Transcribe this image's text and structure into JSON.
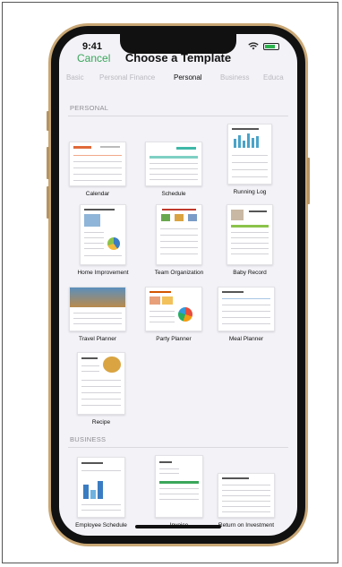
{
  "status": {
    "time": "9:41"
  },
  "nav": {
    "cancel": "Cancel",
    "title": "Choose a Template"
  },
  "tabs": [
    "Basic",
    "Personal Finance",
    "Personal",
    "Business",
    "Educa"
  ],
  "active_tab": "Personal",
  "sections": {
    "personal": {
      "label": "PERSONAL",
      "templates": [
        "Calendar",
        "Schedule",
        "Running Log",
        "Home Improvement",
        "Team Organization",
        "Baby Record",
        "Travel Planner",
        "Party Planner",
        "Meal Planner",
        "Recipe"
      ]
    },
    "business": {
      "label": "BUSINESS",
      "templates": [
        "Employee Schedule",
        "Invoice",
        "Return on Investment"
      ]
    }
  },
  "colors": {
    "accent": "#3aa65a",
    "phone_gold": "#c9a775"
  }
}
